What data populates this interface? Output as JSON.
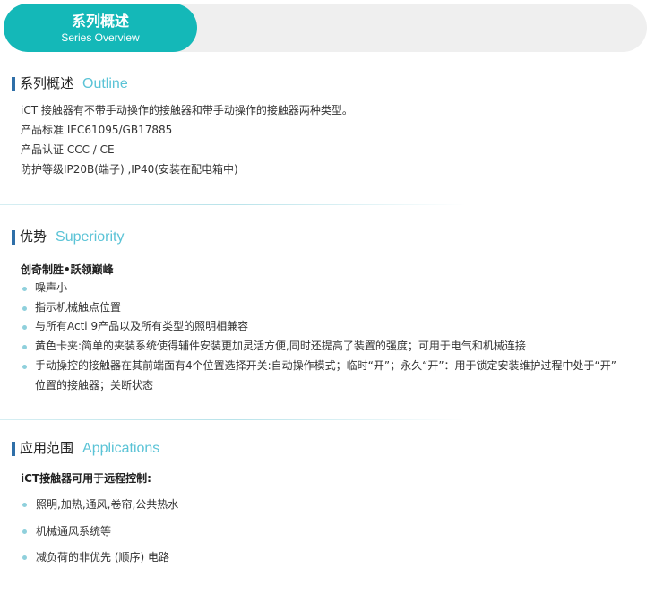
{
  "header": {
    "title_cn": "系列概述",
    "title_en": "Series Overview"
  },
  "outline": {
    "title_cn": "系列概述",
    "title_en": "Outline",
    "lines": [
      "iCT 接触器有不带手动操作的接触器和带手动操作的接触器两种类型。",
      "产品标准 IEC61095/GB17885",
      "产品认证 CCC / CE",
      "防护等级IP20B(端子) ,IP40(安装在配电箱中)"
    ]
  },
  "superiority": {
    "title_cn": "优势",
    "title_en": "Superiority",
    "subheading": "创奇制胜•跃领巅峰",
    "items": [
      "噪声小",
      "指示机械触点位置",
      "与所有Acti 9产品以及所有类型的照明相兼容",
      "黄色卡夹:简单的夹装系统使得辅件安装更加灵活方便,同时还提高了装置的强度；可用于电气和机械连接",
      "手动操控的接触器在其前端面有4个位置选择开关:自动操作模式；临时“开”；永久“开”：用于锁定安装维护过程中处于“开”",
      "位置的接触器；关断状态"
    ]
  },
  "applications": {
    "title_cn": "应用范围",
    "title_en": "Applications",
    "subheading": "iCT接触器可用于远程控制:",
    "items": [
      "照明,加热,通风,卷帘,公共热水",
      "机械通风系统等",
      "减负荷的非优先 (顺序) 电路"
    ]
  },
  "colors": {
    "accent": "#14b8b8",
    "heading_en": "#5ac3d6",
    "marker": "#2f6fa8",
    "bullet": "#8fd0dc"
  }
}
